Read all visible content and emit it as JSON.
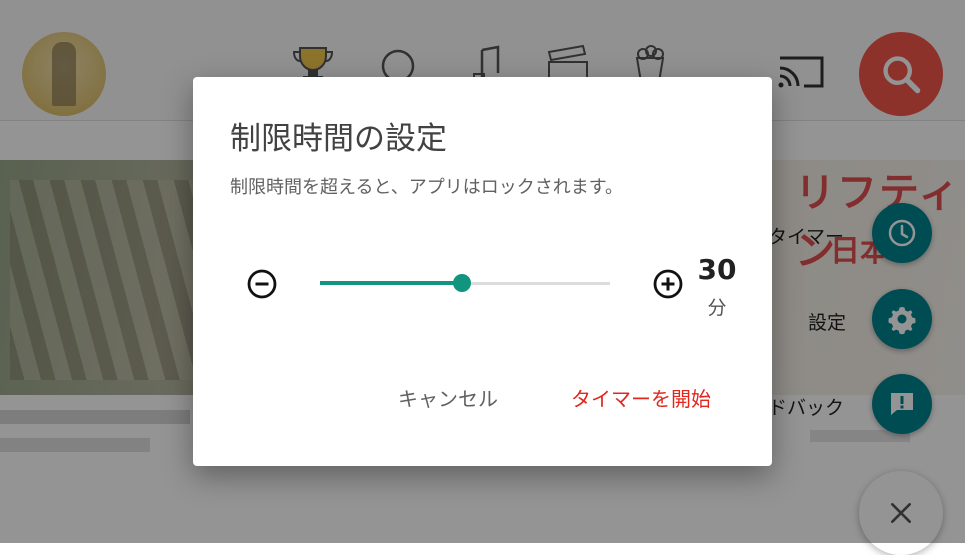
{
  "background": {
    "banner_text": "リフティン",
    "banner_sub": "日本",
    "fab_items": [
      {
        "label": "タイマー",
        "icon": "clock-icon"
      },
      {
        "label": "設定",
        "icon": "gear-icon"
      },
      {
        "label": "ドバック",
        "icon": "feedback-icon"
      }
    ],
    "close_icon": "close-icon"
  },
  "dialog": {
    "title": "制限時間の設定",
    "message": "制限時間を超えると、アプリはロックされます。",
    "slider": {
      "value": 30,
      "fraction": 0.49
    },
    "value": "30",
    "unit": "分",
    "decrement_icon": "minus-circle-icon",
    "increment_icon": "plus-circle-icon",
    "cancel_label": "キャンセル",
    "start_label": "タイマーを開始"
  },
  "colors": {
    "accent": "#11957e",
    "start_button": "#e0281e",
    "fab": "#00838f",
    "search": "#f2574a"
  }
}
